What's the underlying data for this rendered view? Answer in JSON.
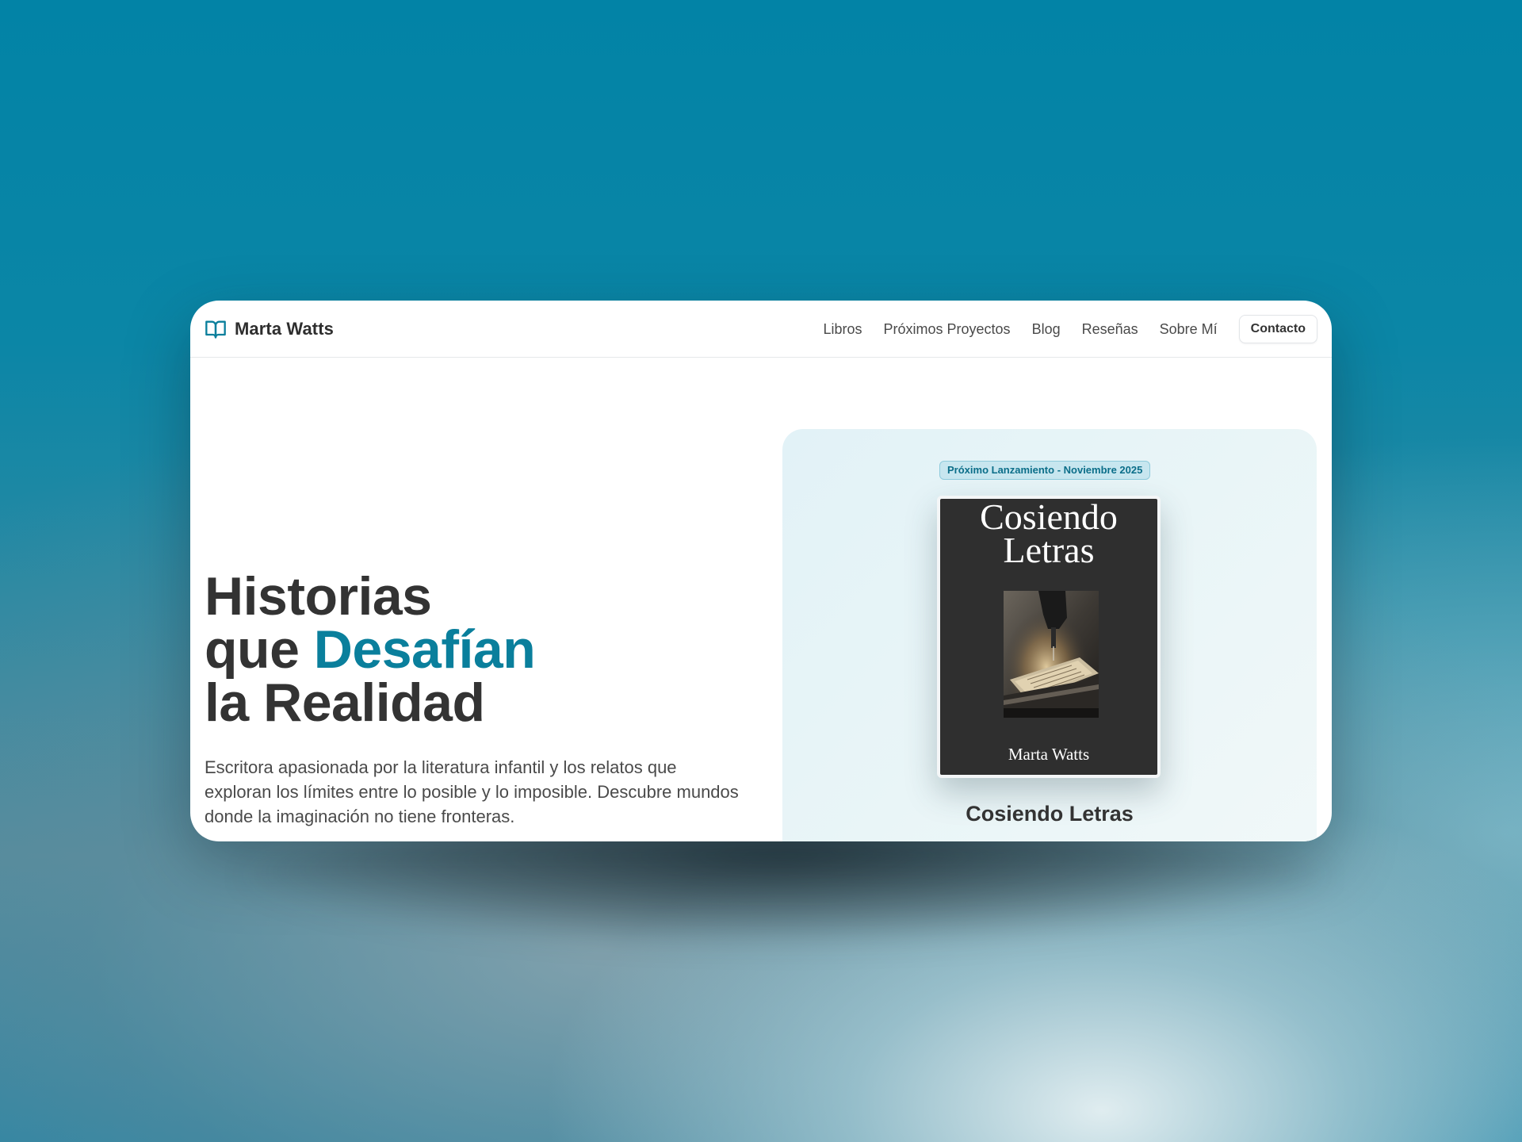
{
  "nav": {
    "brand_name": "Marta Watts",
    "brand_icon": "open-book-icon",
    "links": [
      "Libros",
      "Próximos Proyectos",
      "Blog",
      "Reseñas",
      "Sobre Mí"
    ],
    "contact_label": "Contacto"
  },
  "hero": {
    "title_line1": "Historias",
    "title_line2_prefix": "que ",
    "title_line2_accent": "Desafían",
    "title_line3": "la Realidad",
    "description": "Escritora apasionada por la literatura infantil y los relatos que exploran los límites entre lo posible y lo imposible. Descubre mundos donde la imaginación no tiene fronteras."
  },
  "feature": {
    "badge": "Próximo Lanzamiento - Noviembre 2025",
    "cover_title_line1": "Cosiendo",
    "cover_title_line2": "Letras",
    "cover_author": "Marta Watts",
    "cover_image_icon": "sewing-machine-photo",
    "book_title": "Cosiendo Letras"
  },
  "colors": {
    "accent": "#0a7f9c",
    "text_dark": "#333333",
    "cover_background": "#2f2f2f",
    "badge_background": "#c7e6ef"
  }
}
